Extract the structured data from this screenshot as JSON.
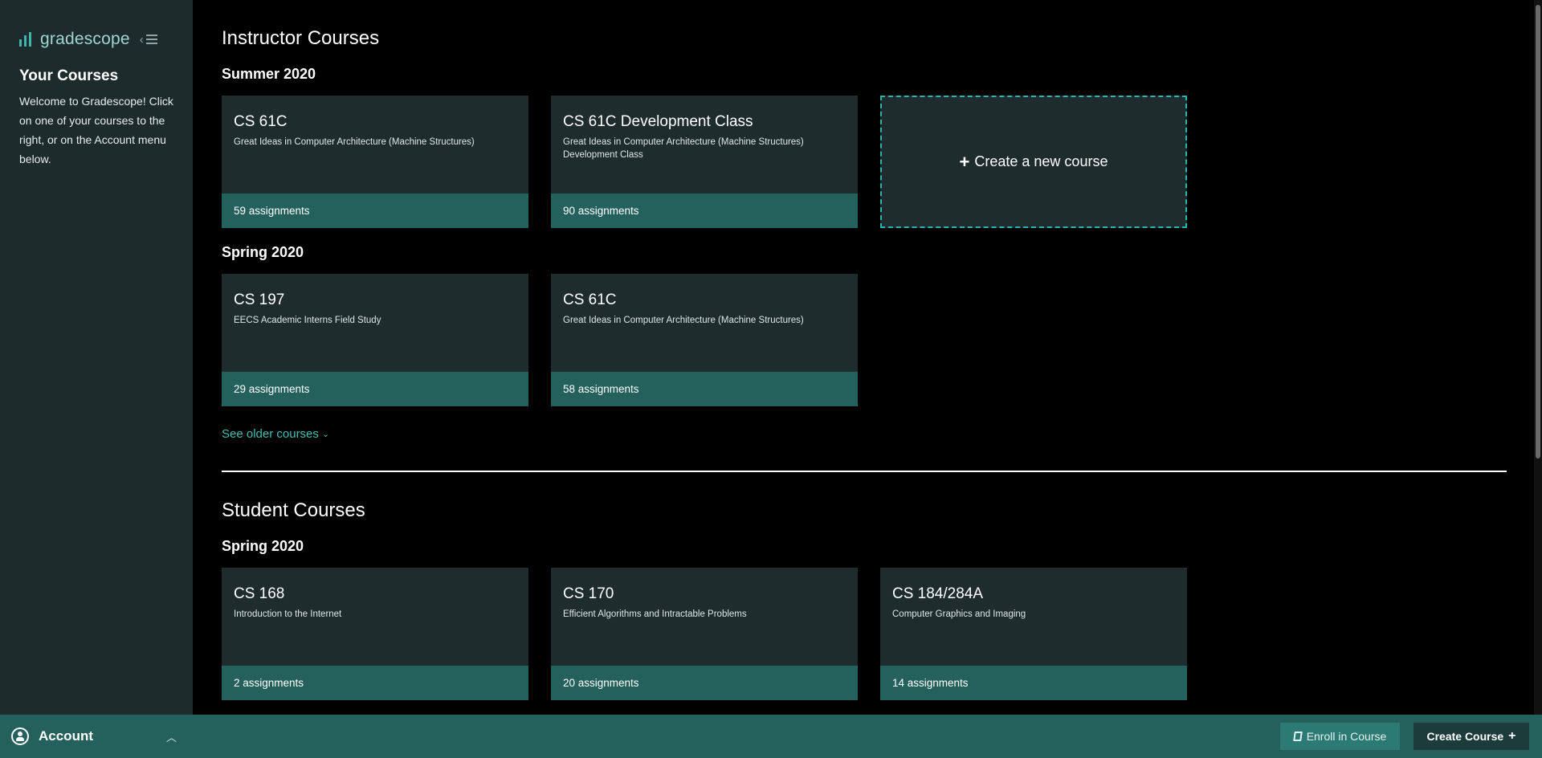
{
  "sidebar": {
    "brand": "gradescope",
    "title": "Your Courses",
    "welcome": "Welcome to Gradescope! Click on one of your courses to the right, or on the Account menu below."
  },
  "instructor": {
    "heading": "Instructor Courses",
    "terms": [
      {
        "term": "Summer 2020",
        "courses": [
          {
            "code": "CS 61C",
            "desc": "Great Ideas in Computer Architecture (Machine Structures)",
            "assignments": "59 assignments"
          },
          {
            "code": "CS 61C Development Class",
            "desc": "Great Ideas in Computer Architecture (Machine Structures) Development Class",
            "assignments": "90 assignments"
          }
        ],
        "create_label": "Create a new course"
      },
      {
        "term": "Spring 2020",
        "courses": [
          {
            "code": "CS 197",
            "desc": "EECS Academic Interns Field Study",
            "assignments": "29 assignments"
          },
          {
            "code": "CS 61C",
            "desc": "Great Ideas in Computer Architecture (Machine Structures)",
            "assignments": "58 assignments"
          }
        ]
      }
    ],
    "see_older": "See older courses"
  },
  "student": {
    "heading": "Student Courses",
    "terms": [
      {
        "term": "Spring 2020",
        "courses": [
          {
            "code": "CS 168",
            "desc": "Introduction to the Internet",
            "assignments": "2 assignments"
          },
          {
            "code": "CS 170",
            "desc": "Efficient Algorithms and Intractable Problems",
            "assignments": "20 assignments"
          },
          {
            "code": "CS 184/284A",
            "desc": "Computer Graphics and Imaging",
            "assignments": "14 assignments"
          }
        ]
      }
    ]
  },
  "footer": {
    "account": "Account",
    "enroll": "Enroll in Course",
    "create": "Create Course"
  },
  "icons": {
    "logo": "bar-chart-logo-icon",
    "collapse": "collapse-sidebar-icon",
    "account": "user-circle-icon",
    "enroll": "book-icon",
    "create": "plus-icon"
  },
  "colors": {
    "sidebar_bg": "#1e2b2d",
    "card_bg": "#1f2c2e",
    "accent": "#24615d",
    "link": "#42bfb7"
  }
}
